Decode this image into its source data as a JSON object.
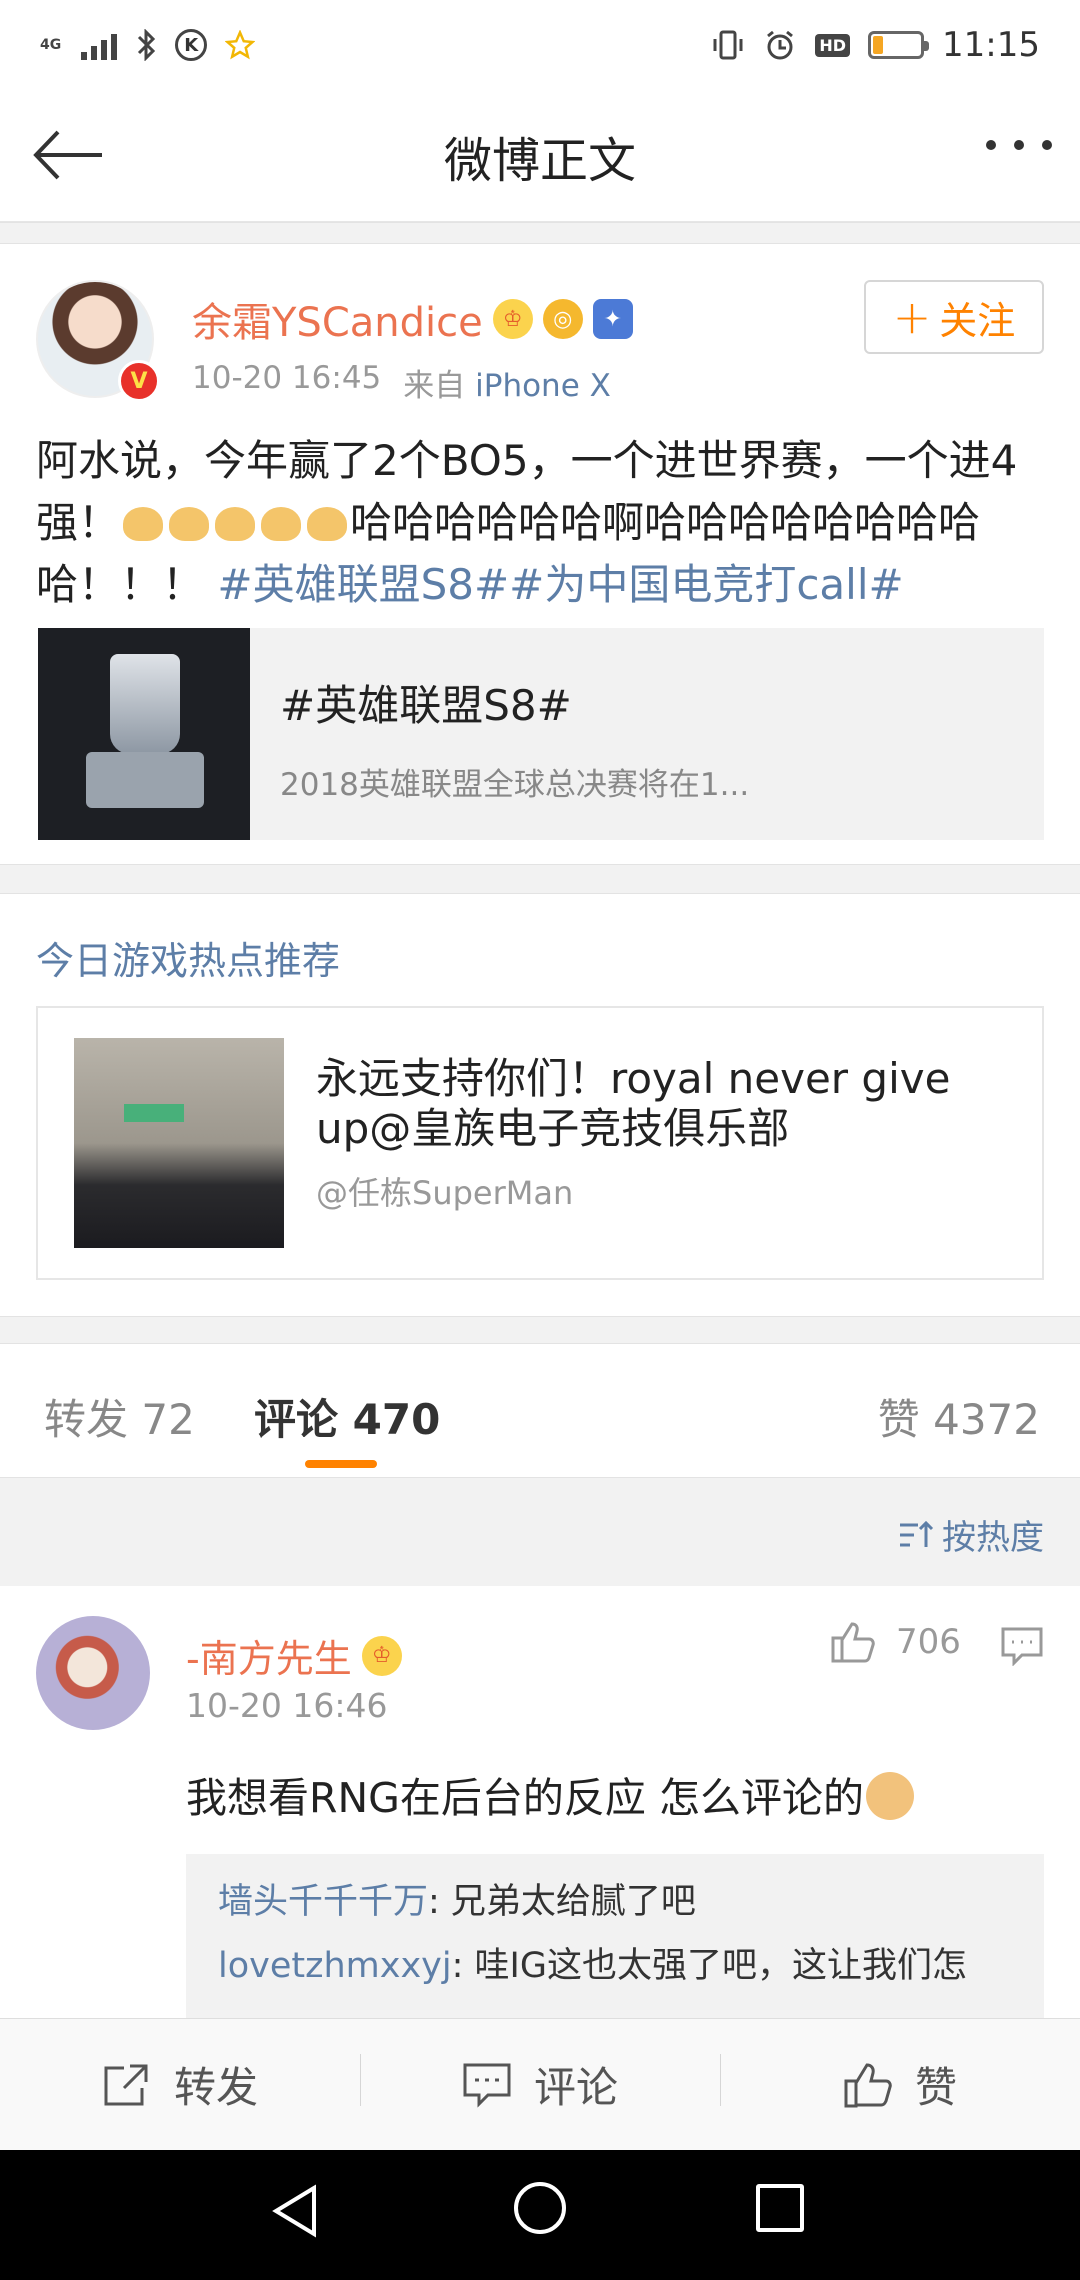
{
  "status_bar": {
    "network": "4G",
    "time": "11:15",
    "battery_level": 0.2
  },
  "nav": {
    "title": "微博正文"
  },
  "post": {
    "author": "余霜YSCandice",
    "time": "10-20 16:45",
    "source_prefix": "来自",
    "source": "iPhone X",
    "follow_label": "关注",
    "text_part1": "阿水说，今年赢了2个BO5，一个进世界赛，一个进4强！",
    "text_part2": "哈哈哈哈哈哈啊哈哈哈哈哈哈哈哈哈！！！",
    "hashtags": "#英雄联盟S8##为中国电竞打call#",
    "topic_card": {
      "title": "#英雄联盟S8#",
      "desc": "2018英雄联盟全球总决赛将在1..."
    }
  },
  "recommend": {
    "section_title": "今日游戏热点推荐",
    "card_text": "永远支持你们！royal never give up@皇族电子竞技俱乐部",
    "card_user": "@任栋SuperMan"
  },
  "tabs": {
    "repost": "转发 72",
    "comment": "评论 470",
    "like": "赞 4372"
  },
  "sort": {
    "label": "按热度"
  },
  "comment": {
    "author": "-南方先生",
    "time": "10-20 16:46",
    "likes": "706",
    "text": "我想看RNG在后台的反应  怎么评论的",
    "replies": [
      {
        "user": "墙头千千千万",
        "text": ": 兄弟太给腻了吧"
      },
      {
        "user": "lovetzhmxxyj",
        "text": ": 哇IG这也太强了吧，这让我们怎"
      }
    ]
  },
  "action_bar": {
    "repost": "转发",
    "comment": "评论",
    "like": "赞"
  }
}
